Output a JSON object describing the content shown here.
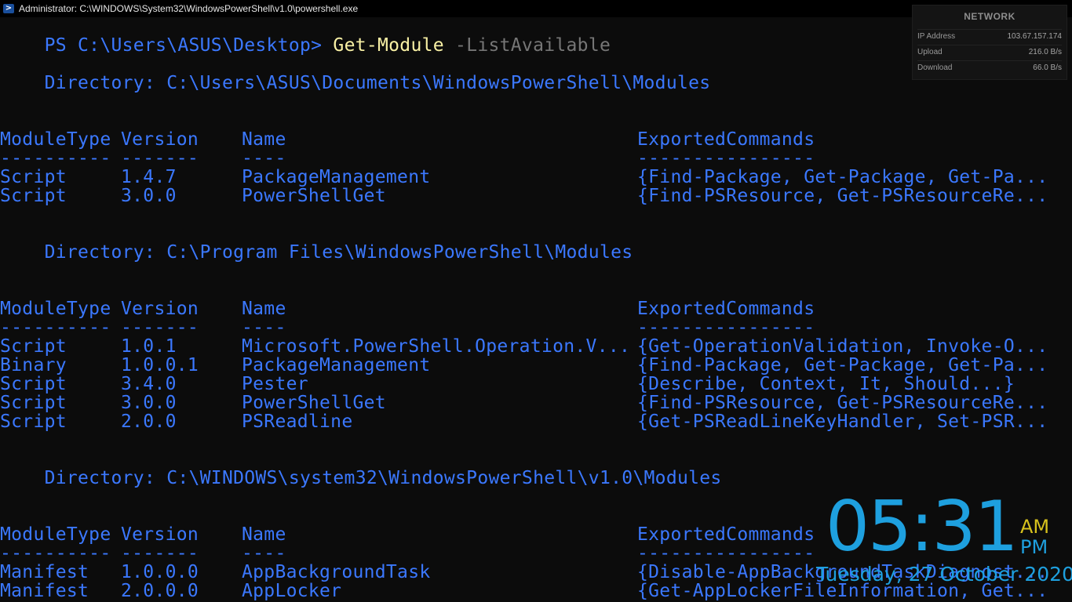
{
  "window": {
    "title": "Administrator: C:\\WINDOWS\\System32\\WindowsPowerShell\\v1.0\\powershell.exe",
    "close_glyph": "✕"
  },
  "console": {
    "prompt": "PS C:\\Users\\ASUS\\Desktop> ",
    "command": "Get-Module",
    "parameter": " -ListAvailable",
    "column_headers": [
      "ModuleType",
      "Version",
      "Name",
      "ExportedCommands"
    ],
    "header_rules": [
      "----------",
      "-------",
      "----",
      "----------------"
    ],
    "sections": [
      {
        "directory": "    Directory: C:\\Users\\ASUS\\Documents\\WindowsPowerShell\\Modules",
        "rows": [
          [
            "Script",
            "1.4.7",
            "PackageManagement",
            "{Find-Package, Get-Package, Get-Pa..."
          ],
          [
            "Script",
            "3.0.0",
            "PowerShellGet",
            "{Find-PSResource, Get-PSResourceRe..."
          ]
        ]
      },
      {
        "directory": "    Directory: C:\\Program Files\\WindowsPowerShell\\Modules",
        "rows": [
          [
            "Script",
            "1.0.1",
            "Microsoft.PowerShell.Operation.V...",
            "{Get-OperationValidation, Invoke-O..."
          ],
          [
            "Binary",
            "1.0.0.1",
            "PackageManagement",
            "{Find-Package, Get-Package, Get-Pa..."
          ],
          [
            "Script",
            "3.4.0",
            "Pester",
            "{Describe, Context, It, Should...}"
          ],
          [
            "Script",
            "3.0.0",
            "PowerShellGet",
            "{Find-PSResource, Get-PSResourceRe..."
          ],
          [
            "Script",
            "2.0.0",
            "PSReadline",
            "{Get-PSReadLineKeyHandler, Set-PSR..."
          ]
        ]
      },
      {
        "directory": "    Directory: C:\\WINDOWS\\system32\\WindowsPowerShell\\v1.0\\Modules",
        "rows": [
          [
            "Manifest",
            "1.0.0.0",
            "AppBackgroundTask",
            "{Disable-AppBackgroundTaskDiagnost..."
          ],
          [
            "Manifest",
            "2.0.0.0",
            "AppLocker",
            "{Get-AppLockerFileInformation, Get..."
          ]
        ]
      }
    ]
  },
  "network_widget": {
    "title": "NETWORK",
    "rows": [
      {
        "label": "IP Address",
        "value": "103.67.157.174"
      },
      {
        "label": "Upload",
        "value": "216.0 B/s"
      },
      {
        "label": "Download",
        "value": "66.0 B/s"
      }
    ]
  },
  "clock_widget": {
    "time": "05:31",
    "am": "AM",
    "pm": "PM",
    "date": "Tuesday, 27 October 2020"
  },
  "colors": {
    "console_bg": "#0c0c0c",
    "text_blue": "#3b78ff",
    "command_yellow": "#f9f1a5",
    "param_gray": "#767676",
    "clock_blue": "#1ea0df",
    "am_yellow": "#d7c21d"
  }
}
